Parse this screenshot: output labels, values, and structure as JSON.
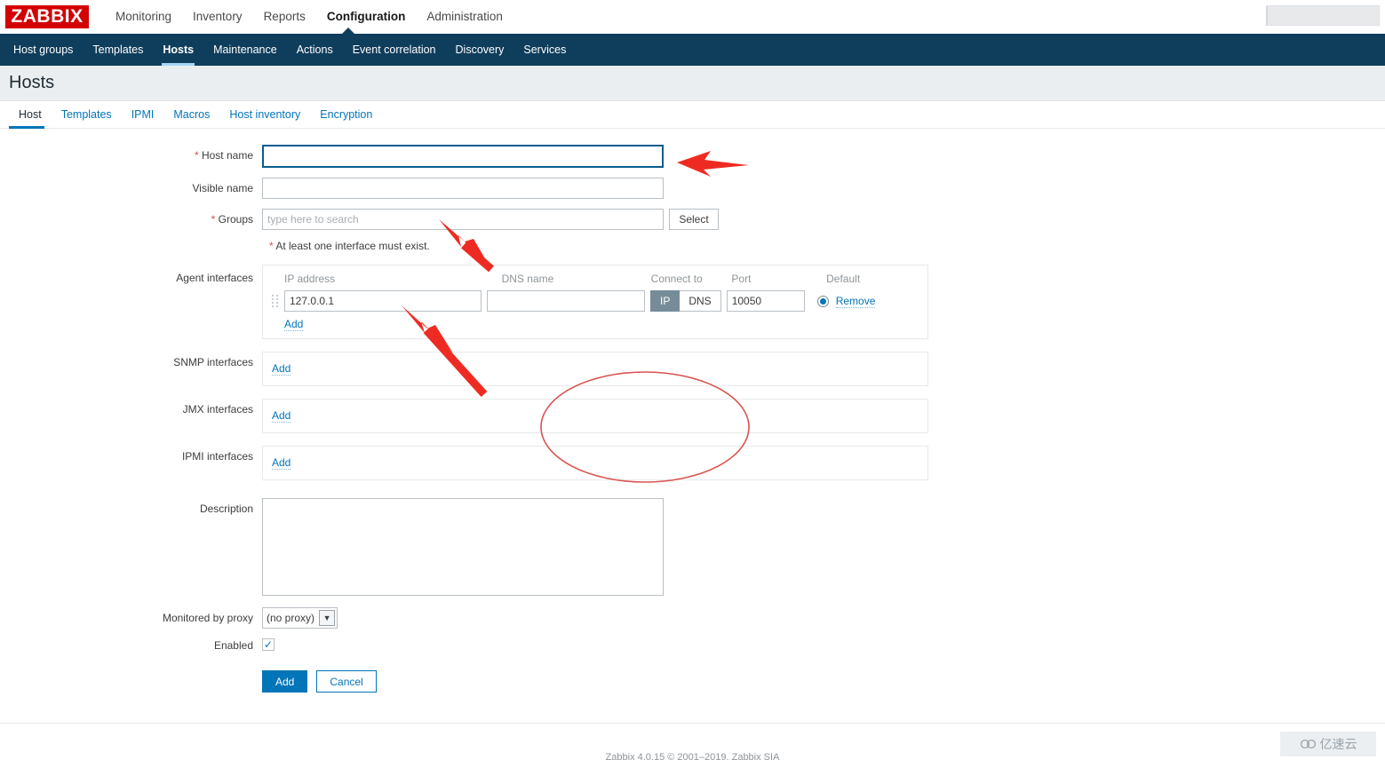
{
  "header": {
    "logo_text": "ZABBIX",
    "nav": [
      {
        "label": "Monitoring",
        "active": false
      },
      {
        "label": "Inventory",
        "active": false
      },
      {
        "label": "Reports",
        "active": false
      },
      {
        "label": "Configuration",
        "active": true
      },
      {
        "label": "Administration",
        "active": false
      }
    ],
    "search_placeholder": ""
  },
  "subnav": {
    "items": [
      {
        "label": "Host groups",
        "active": false
      },
      {
        "label": "Templates",
        "active": false
      },
      {
        "label": "Hosts",
        "active": true
      },
      {
        "label": "Maintenance",
        "active": false
      },
      {
        "label": "Actions",
        "active": false
      },
      {
        "label": "Event correlation",
        "active": false
      },
      {
        "label": "Discovery",
        "active": false
      },
      {
        "label": "Services",
        "active": false
      }
    ]
  },
  "page": {
    "title": "Hosts"
  },
  "tabs": [
    {
      "label": "Host",
      "active": true
    },
    {
      "label": "Templates",
      "active": false
    },
    {
      "label": "IPMI",
      "active": false
    },
    {
      "label": "Macros",
      "active": false
    },
    {
      "label": "Host inventory",
      "active": false
    },
    {
      "label": "Encryption",
      "active": false
    }
  ],
  "form": {
    "host_name": {
      "label": "Host name",
      "required_marker": "*",
      "value": "",
      "placeholder": ""
    },
    "visible_name": {
      "label": "Visible name",
      "value": "",
      "placeholder": ""
    },
    "groups": {
      "label": "Groups",
      "required_marker": "*",
      "value": "",
      "placeholder": "type here to search",
      "select_button": "Select"
    },
    "interface_note": {
      "marker": "*",
      "text": "At least one interface must exist."
    },
    "agent_interfaces": {
      "label": "Agent interfaces",
      "columns": {
        "ip": "IP address",
        "dns": "DNS name",
        "connect_to": "Connect to",
        "port": "Port",
        "default": "Default"
      },
      "rows": [
        {
          "ip": "127.0.0.1",
          "dns": "",
          "connect_to_selected": "IP",
          "connect_options": [
            "IP",
            "DNS"
          ],
          "port": "10050",
          "is_default": true,
          "remove_label": "Remove"
        }
      ],
      "add_label": "Add"
    },
    "snmp_interfaces": {
      "label": "SNMP interfaces",
      "add_label": "Add"
    },
    "jmx_interfaces": {
      "label": "JMX interfaces",
      "add_label": "Add"
    },
    "ipmi_interfaces": {
      "label": "IPMI interfaces",
      "add_label": "Add"
    },
    "description": {
      "label": "Description",
      "value": "",
      "placeholder": ""
    },
    "monitored_by_proxy": {
      "label": "Monitored by proxy",
      "selected": "(no proxy)",
      "options": [
        "(no proxy)"
      ]
    },
    "enabled": {
      "label": "Enabled",
      "checked": true,
      "check_glyph": "✓"
    },
    "actions": {
      "submit_label": "Add",
      "cancel_label": "Cancel"
    }
  },
  "footer": {
    "copyright": "Zabbix 4.0.15 © 2001–2019, Zabbix SIA",
    "watermark_text": "亿速云"
  },
  "annotations": {
    "accent_color": "#ee2b22",
    "ellipse_color": "#d9534f",
    "arrow_count": 3,
    "ellipse_count": 1
  },
  "colors": {
    "brand_red": "#d40000",
    "subnav_bg": "#0f3d5c",
    "link_blue": "#0275b8",
    "page_header_bg": "#ebeef0",
    "toggle_on_bg": "#768d99",
    "required_star": "#d64e4e"
  }
}
